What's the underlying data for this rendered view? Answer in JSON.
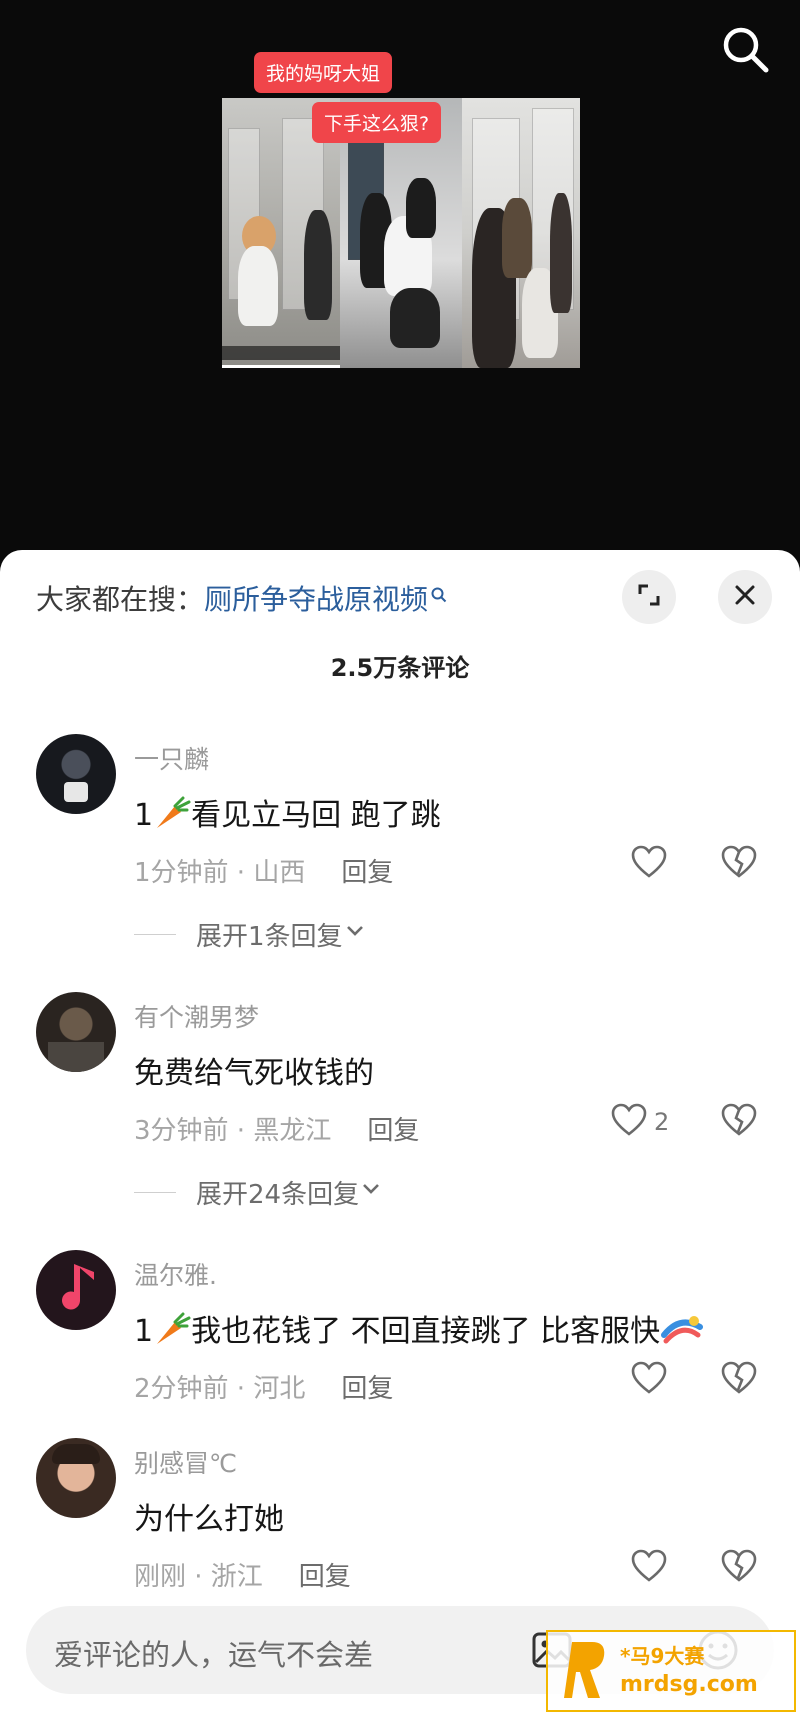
{
  "video": {
    "caption_top": "我的妈呀大姐",
    "caption_bottom": "下手这么狠?"
  },
  "sheet": {
    "hot_search_label": "大家都在搜：",
    "hot_search_term": "厕所争夺战原视频",
    "comment_count": "2.5万条评论"
  },
  "comments": [
    {
      "username": "一只麟",
      "text_prefix": "1",
      "text": "看见立马回 跑了跳",
      "time_location": "1分钟前 · 山西",
      "reply_label": "回复",
      "likes": "",
      "expand_label": "展开1条回复"
    },
    {
      "username": "有个潮男梦",
      "text_prefix": "",
      "text": "免费给气死收钱的",
      "time_location": "3分钟前 · 黑龙江",
      "reply_label": "回复",
      "likes": "2",
      "expand_label": "展开24条回复"
    },
    {
      "username": "温尔雅.",
      "text_prefix": "1",
      "text": "我也花钱了 不回直接跳了 比客服快",
      "time_location": "2分钟前 · 河北",
      "reply_label": "回复",
      "likes": "",
      "expand_label": ""
    },
    {
      "username": "别感冒℃",
      "text_prefix": "",
      "text": "为什么打她",
      "time_location": "刚刚 · 浙江",
      "reply_label": "回复",
      "likes": "",
      "expand_label": ""
    }
  ],
  "input": {
    "placeholder": "爱评论的人，运气不会差"
  },
  "watermark": {
    "line1": "*马9大赛",
    "line2": "mrdsg.com"
  },
  "colors": {
    "caption_bg": "#f0454a",
    "link": "#2b5e9c",
    "sheet_bg": "#ffffff",
    "watermark": "#f3a300"
  },
  "icons": [
    "search-icon",
    "magnifier-small-icon",
    "expand-icon",
    "close-icon",
    "carrot-emoji-icon",
    "heart-icon",
    "broken-heart-icon",
    "chevron-down-icon",
    "image-icon",
    "emoji-icon"
  ]
}
